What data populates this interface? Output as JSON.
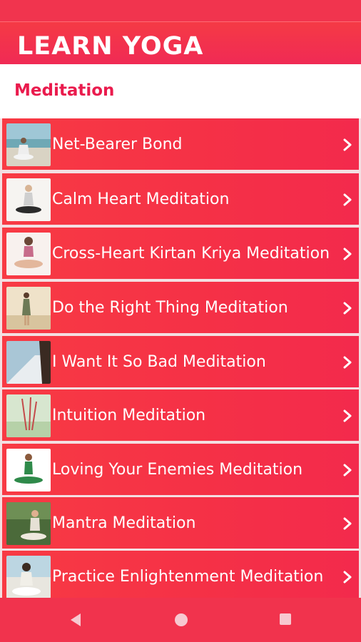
{
  "app": {
    "title": "LEARN YOGA"
  },
  "subheader": {
    "title": "Meditation"
  },
  "items": [
    {
      "label": "Net-Bearer Bond",
      "thumb": "beach-meditation-photo"
    },
    {
      "label": "Calm Heart Meditation",
      "thumb": "seated-meditation-photo"
    },
    {
      "label": "Cross-Heart Kirtan Kriya Meditation",
      "thumb": "seated-pose-photo"
    },
    {
      "label": "Do the Right Thing Meditation",
      "thumb": "standing-beach-photo"
    },
    {
      "label": "I Want It So Bad Meditation",
      "thumb": "side-profile-photo"
    },
    {
      "label": "Intuition Meditation",
      "thumb": "incense-sticks-photo"
    },
    {
      "label": "Loving Your Enemies Meditation",
      "thumb": "green-outfit-pose-photo"
    },
    {
      "label": "Mantra Meditation",
      "thumb": "outdoor-meditation-photo"
    },
    {
      "label": "Practice Enlightenment Meditation",
      "thumb": "seaside-meditation-photo"
    }
  ],
  "nav": {
    "back": "back-icon",
    "home": "home-icon",
    "recents": "recents-icon"
  }
}
